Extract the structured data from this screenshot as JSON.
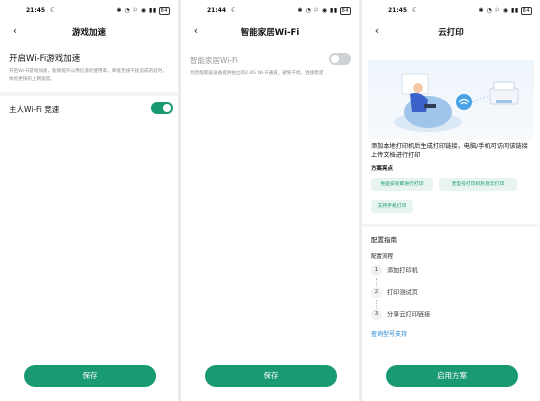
{
  "status": {
    "p1_time": "21:45",
    "p2_time": "21:44",
    "p3_time": "21:45",
    "battery": "84"
  },
  "p1": {
    "title": "游戏加速",
    "heading": "开启Wi-Fi游戏加速",
    "desc": "开启Wi-Fi游戏加速，能够提升公用信道的使用率，降低无线干扰造成的延时，体验更快的上网速度。",
    "row_label": "主人Wi-Fi 竞速",
    "toggle_on": true,
    "save": "保存"
  },
  "p2": {
    "title": "智能家居Wi-Fi",
    "row_label": "智能家居Wi-Fi",
    "desc": "为智能家居设备提供独立的2.4G Wi-Fi通道，避免干扰，连接稳定",
    "toggle_on": false,
    "save": "保存"
  },
  "p3": {
    "title": "云打印",
    "intro": "添加本地打印机后生成打印链接，电脑/手机可访问该链接上传文档进行打印",
    "highlights_title": "方案亮点",
    "chips": [
      "免驱安装即进行打印",
      "老型号打印机秒变云打印",
      "支持手机打印"
    ],
    "guide_title": "配置指南",
    "flow_title": "配置流程",
    "steps": [
      {
        "num": "1",
        "label": "添加打印机"
      },
      {
        "num": "2",
        "label": "打印测试页"
      },
      {
        "num": "3",
        "label": "分享云打印链接"
      }
    ],
    "link": "查询型号支持",
    "apply": "启用方案"
  }
}
